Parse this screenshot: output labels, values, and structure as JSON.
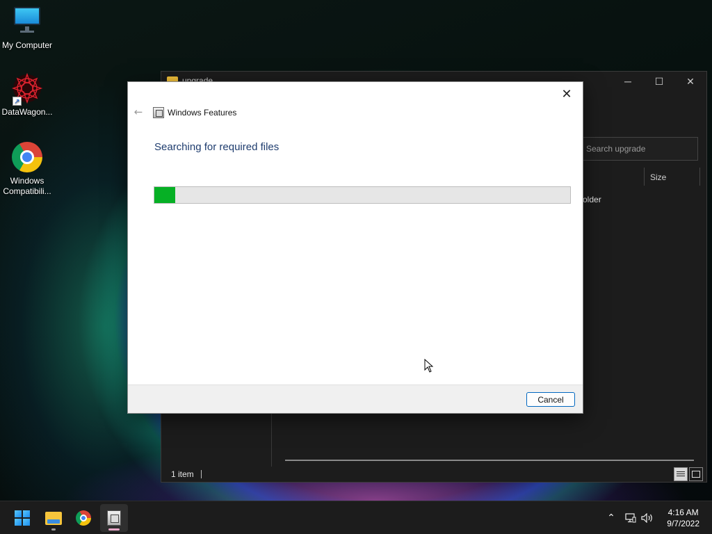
{
  "desktop": {
    "icons": [
      {
        "label": "My Computer",
        "icon": "computer-icon"
      },
      {
        "label": "DataWagon...",
        "icon": "datawagon-app-icon"
      },
      {
        "label": "Windows Compatibili...",
        "icon": "chrome-icon"
      }
    ]
  },
  "explorer": {
    "title": "upgrade",
    "search_placeholder": "Search upgrade",
    "column_size": "Size",
    "row_partial_text": "older",
    "status_items": "1 item"
  },
  "dialog": {
    "title": "Windows Features",
    "heading": "Searching for required files",
    "progress_fraction": 0.05,
    "cancel_label": "Cancel",
    "colors": {
      "progress_fill": "#06b025",
      "heading": "#1e3c6e",
      "button_border": "#0067c0"
    }
  },
  "taskbar": {
    "apps": [
      "start-icon",
      "file-explorer-icon",
      "chrome-icon",
      "windows-features-icon"
    ],
    "time": "4:16 AM",
    "date": "9/7/2022"
  }
}
